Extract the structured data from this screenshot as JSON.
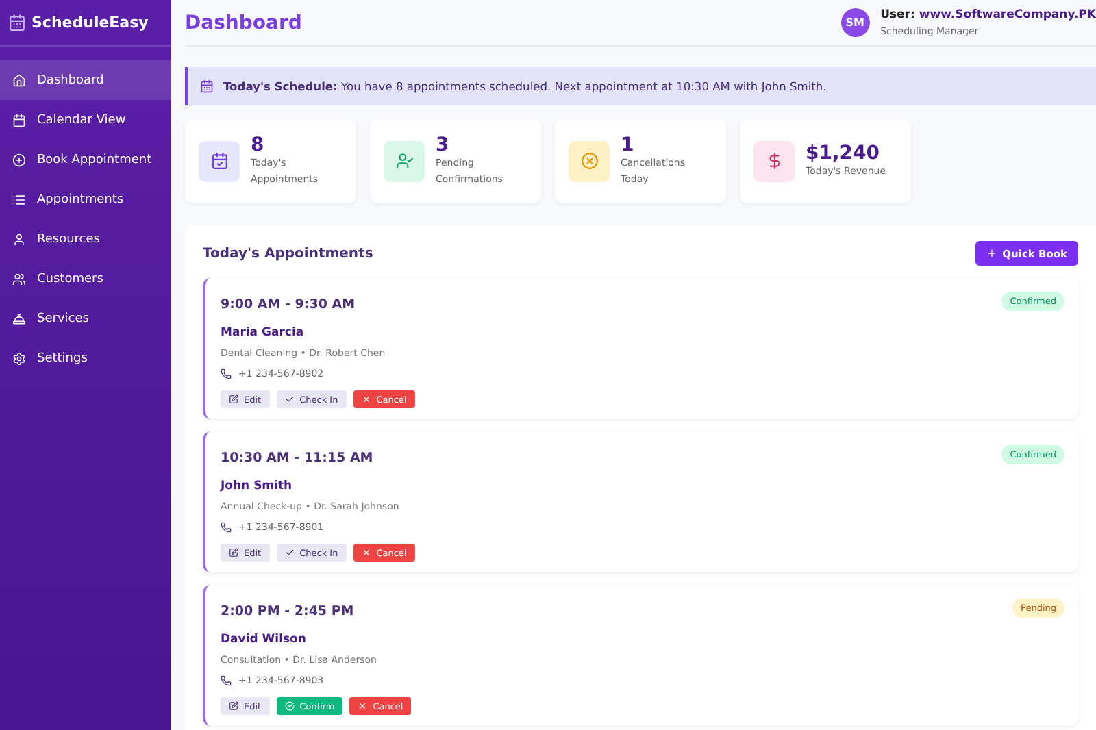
{
  "sidebar": {
    "logo": "ScheduleEasy",
    "items": [
      {
        "kind": "home",
        "label": "Dashboard",
        "selected": true
      },
      {
        "kind": "calendar",
        "label": "Calendar View",
        "selected": false
      },
      {
        "kind": "book",
        "label": "Book Appointment",
        "selected": false
      },
      {
        "kind": "list",
        "label": "Appointments",
        "selected": false
      },
      {
        "kind": "resources",
        "label": "Resources",
        "selected": false
      },
      {
        "kind": "customers",
        "label": "Customers",
        "selected": false
      },
      {
        "kind": "services",
        "label": "Services",
        "selected": false
      },
      {
        "kind": "settings",
        "label": "Settings",
        "selected": false
      }
    ]
  },
  "header": {
    "title": "Dashboard",
    "avatar": "SM",
    "user_label": "User:",
    "user_name": "www.SoftwareCompany.PK",
    "role": "Scheduling Manager"
  },
  "banner": {
    "title": "Today's Schedule:",
    "text": "You have 8 appointments scheduled. Next appointment at 10:30 AM with John Smith."
  },
  "stats": [
    {
      "kind": "appointments",
      "value": "8",
      "label": "Today's Appointments"
    },
    {
      "kind": "pending",
      "value": "3",
      "label": "Pending Confirmations"
    },
    {
      "kind": "cancel",
      "value": "1",
      "label": "Cancellations Today"
    },
    {
      "kind": "revenue",
      "value": "$1,240",
      "label": "Today's Revenue"
    }
  ],
  "appointments": {
    "title": "Today's Appointments",
    "quick_book": "Quick Book",
    "items": [
      {
        "time": "9:00 AM - 9:30 AM",
        "name": "Maria Garcia",
        "detail": "Dental Cleaning • Dr. Robert Chen",
        "phone": "+1 234-567-8902",
        "status": "Confirmed",
        "kind": "confirmed",
        "actions": [
          {
            "kind": "edit",
            "label": "Edit"
          },
          {
            "kind": "checkin",
            "label": "Check In"
          },
          {
            "kind": "cancel",
            "label": "Cancel"
          }
        ]
      },
      {
        "time": "10:30 AM - 11:15 AM",
        "name": "John Smith",
        "detail": "Annual Check-up • Dr. Sarah Johnson",
        "phone": "+1 234-567-8901",
        "status": "Confirmed",
        "kind": "confirmed",
        "actions": [
          {
            "kind": "edit",
            "label": "Edit"
          },
          {
            "kind": "checkin",
            "label": "Check In"
          },
          {
            "kind": "cancel",
            "label": "Cancel"
          }
        ]
      },
      {
        "time": "2:00 PM - 2:45 PM",
        "name": "David Wilson",
        "detail": "Consultation • Dr. Lisa Anderson",
        "phone": "+1 234-567-8903",
        "status": "Pending",
        "kind": "pending",
        "actions": [
          {
            "kind": "edit",
            "label": "Edit"
          },
          {
            "kind": "confirm",
            "label": "Confirm"
          },
          {
            "kind": "cancel",
            "label": "Cancel"
          }
        ]
      }
    ]
  }
}
